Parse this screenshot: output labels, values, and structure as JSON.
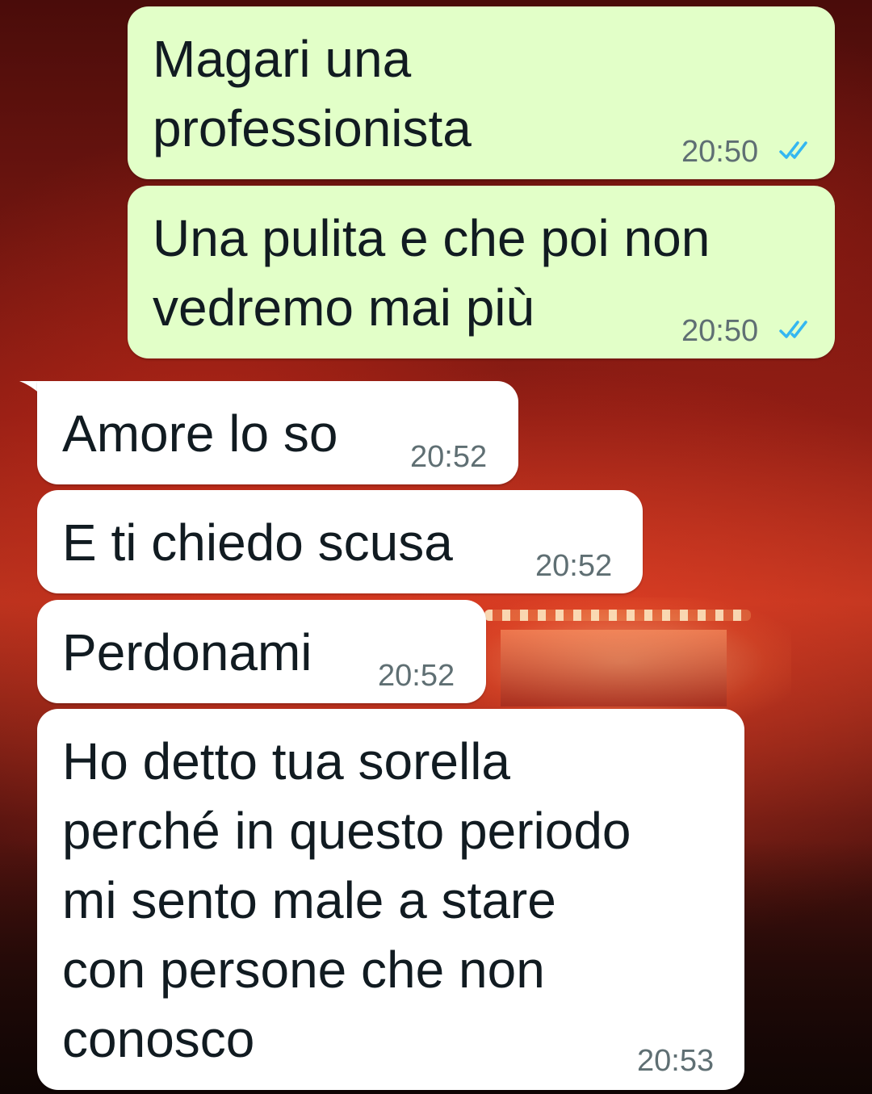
{
  "colors": {
    "outgoing_bubble": "#e2ffc8",
    "incoming_bubble": "#ffffff",
    "text": "#111b21",
    "timestamp": "#5f6f73",
    "read_ticks": "#34b7f1"
  },
  "messages": [
    {
      "direction": "outgoing",
      "text": "Magari una\nprofessionista",
      "time": "20:50",
      "status": "read",
      "status_icon": "double-check-icon"
    },
    {
      "direction": "outgoing",
      "text": "Una pulita e che poi non\nvedremo mai più",
      "time": "20:50",
      "status": "read",
      "status_icon": "double-check-icon"
    },
    {
      "direction": "incoming",
      "text": "Amore lo so",
      "time": "20:52"
    },
    {
      "direction": "incoming",
      "text": "E ti chiedo scusa",
      "time": "20:52"
    },
    {
      "direction": "incoming",
      "text": "Perdonami",
      "time": "20:52"
    },
    {
      "direction": "incoming",
      "text": "Ho detto tua sorella\nperché in questo periodo\nmi sento male a stare\ncon persone che non\nconosco",
      "time": "20:53"
    }
  ]
}
